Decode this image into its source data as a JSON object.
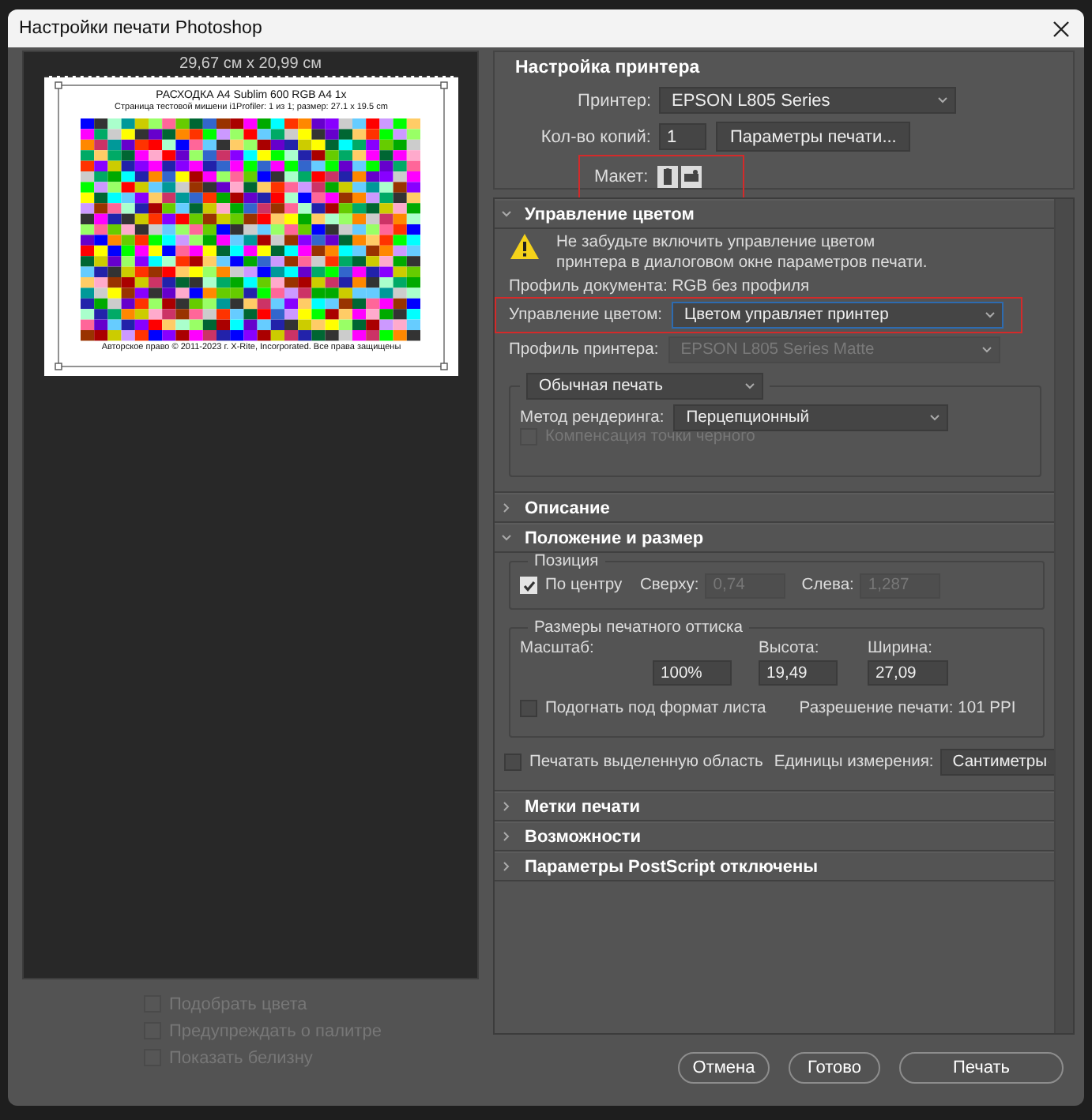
{
  "window": {
    "title": "Настройки печати Photoshop"
  },
  "preview": {
    "size_label": "29,67 см x 20,99 см",
    "page": {
      "title": "РАСХОДКА A4 Sublim 600 RGB A4 1x",
      "subtitle": "Страница тестовой мишени i1Profiler: 1 из 1; размер: 27.1 x 19.5 cm",
      "footer": "Авторское право © 2011-2023 г. X-Rite, Incorporated. Все права защищены"
    }
  },
  "preview_options": [
    {
      "label": "Подобрать цвета",
      "checked": false,
      "disabled": true
    },
    {
      "label": "Предупреждать о палитре",
      "checked": false,
      "disabled": true
    },
    {
      "label": "Показать белизну",
      "checked": false,
      "disabled": true
    }
  ],
  "printer_setup": {
    "title": "Настройка принтера",
    "printer_label": "Принтер:",
    "printer": "EPSON L805 Series",
    "copies_label": "Кол-во копий:",
    "copies": "1",
    "print_settings_button": "Параметры печати...",
    "layout_label": "Макет:",
    "layout_highlighted": true
  },
  "sections": [
    {
      "kind": "color",
      "title": "Управление цветом",
      "expanded": true,
      "warning": "Не забудьте включить управление цветом\nпринтера в диалоговом окне параметров печати.",
      "document_profile": "Профиль документа: RGB без профиля",
      "color_handling_label": "Управление цветом:",
      "color_handling": "Цветом управляет принтер",
      "color_handling_highlighted": true,
      "printer_profile_label": "Профиль принтера:",
      "printer_profile": "EPSON L805 Series Matte",
      "printer_profile_disabled": true,
      "proof_mode": "Обычная печать",
      "rendering_label": "Метод рендеринга:",
      "rendering": "Перцепционный",
      "black_point": {
        "label": "Компенсация точки черного",
        "checked": false,
        "disabled": true
      }
    },
    {
      "kind": "plain",
      "title": "Описание",
      "expanded": false
    },
    {
      "kind": "position",
      "title": "Положение и размер",
      "expanded": true,
      "position_title": "Позиция",
      "center": {
        "label": "По центру",
        "checked": true
      },
      "top": {
        "label": "Сверху:",
        "value": "0,74",
        "disabled": true
      },
      "left": {
        "label": "Слева:",
        "value": "1,287",
        "disabled": true
      },
      "size_title": "Размеры печатного оттиска",
      "scale": {
        "label": "Масштаб:",
        "value": "100%"
      },
      "height": {
        "label": "Высота:",
        "value": "19,49"
      },
      "width": {
        "label": "Ширина:",
        "value": "27,09"
      },
      "fit": {
        "label": "Подогнать под формат листа",
        "checked": false
      },
      "resolution": "Разрешение печати: 101 PPI",
      "print_selection": {
        "label": "Печатать выделенную область",
        "checked": false
      },
      "units_label": "Единицы измерения:",
      "units": "Сантиметры"
    },
    {
      "kind": "plain",
      "title": "Метки печати",
      "expanded": false
    },
    {
      "kind": "plain",
      "title": "Возможности",
      "expanded": false
    },
    {
      "kind": "plain",
      "title": "Параметры PostScript отключены",
      "expanded": false
    }
  ],
  "buttons": [
    {
      "label": "Отмена",
      "kind": "secondary"
    },
    {
      "label": "Готово",
      "kind": "secondary"
    },
    {
      "label": "Печать",
      "kind": "primary"
    }
  ]
}
